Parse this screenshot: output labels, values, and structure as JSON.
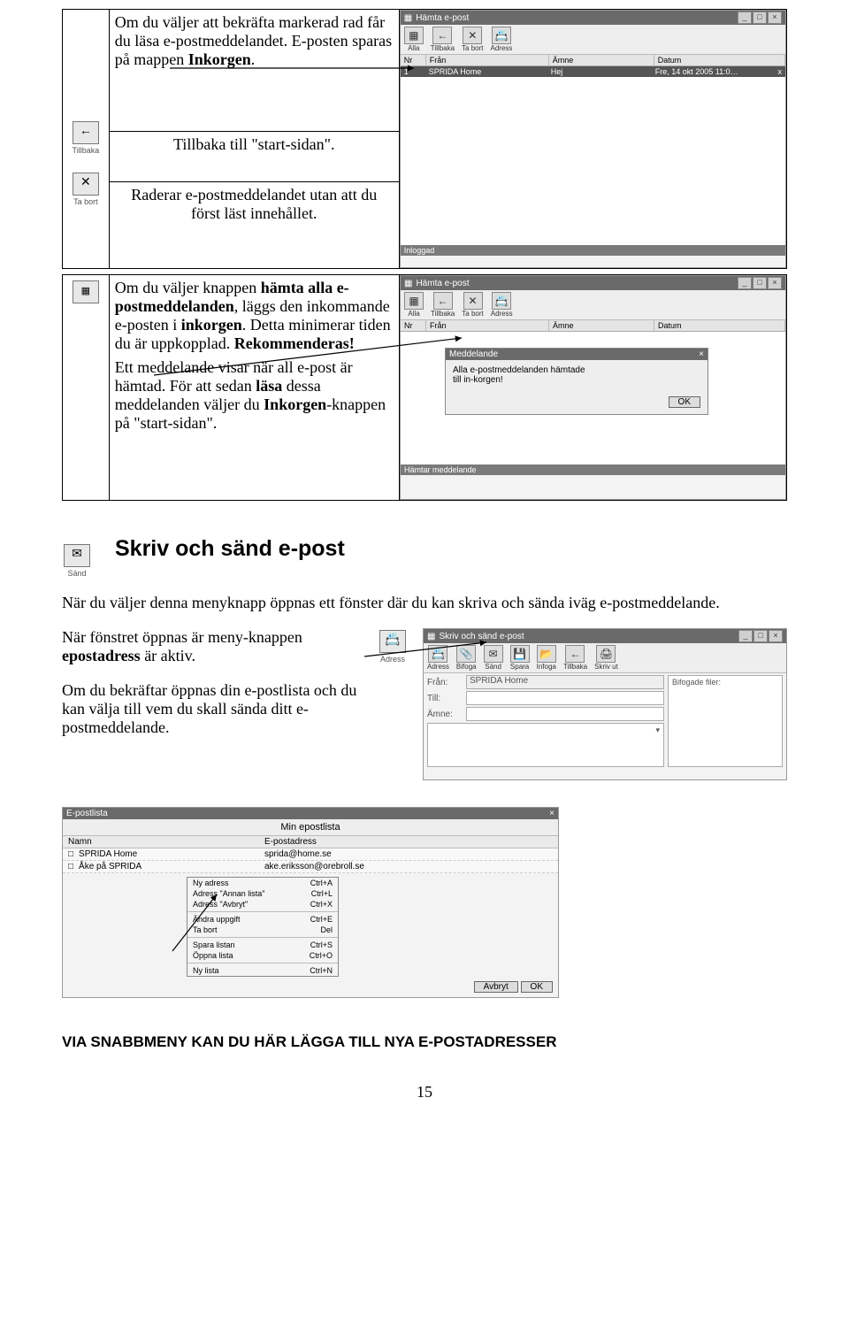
{
  "row1": {
    "para1_a": "Om du väljer att bekräfta markerad rad får du läsa e-postmeddelandet. E-posten sparas på mappen ",
    "para1_b": "Inkorgen",
    "para1_c": ".",
    "para2": "Tillbaka till \"start-sidan\".",
    "para3": "Raderar e-postmeddelandet utan att du först läst innehållet.",
    "tillbaka_label": "Tillbaka",
    "tabort_label": "Ta bort"
  },
  "win1": {
    "title": "Hämta e-post",
    "tb": {
      "alla": "Alla",
      "tillbaka": "Tillbaka",
      "tabort": "Ta bort",
      "adress": "Adress"
    },
    "cols": {
      "nr": "Nr",
      "fran": "Från",
      "amne": "Ämne",
      "datum": "Datum"
    },
    "row": {
      "nr": "1",
      "fran": "SPRIDA Home",
      "amne": "Hej",
      "datum": "Fre, 14 okt 2005 11:0…",
      "x": "x"
    },
    "status": "Inloggad"
  },
  "row2": {
    "p1_a": "Om du väljer knappen ",
    "p1_b": "hämta alla e-postmeddelanden",
    "p1_c": ", läggs den inkommande e-posten i ",
    "p1_d": "inkorgen",
    "p1_e": ". Detta minimerar tiden du är uppkopplad. ",
    "p1_f": "Rekommenderas!",
    "p2_a": "Ett meddelande visar när all e-post är hämtad. För att sedan ",
    "p2_b": "läsa",
    "p2_c": " dessa meddelanden väljer du ",
    "p2_d": "Inkorgen",
    "p2_e": "-knappen på \"start-sidan\"."
  },
  "win2": {
    "title": "Hämta e-post",
    "dlg": {
      "title": "Meddelande",
      "line1": "Alla e-postmeddelanden hämtade",
      "line2": "till in-korgen!",
      "ok": "OK"
    },
    "status": "Hämtar meddelande"
  },
  "section_send": {
    "heading": "Skriv och sänd e-post",
    "send_label": "Sänd",
    "p1": "När du väljer denna menyknapp öppnas ett fönster där du kan skriva och sända iväg e-postmeddelande.",
    "p2_a": "När fönstret öppnas är meny-knappen ",
    "p2_b": "epostadress",
    "p2_c": " är aktiv.",
    "adress_label": "Adress",
    "p3": "Om du bekräftar öppnas din e-postlista och du kan välja till vem du skall sända ditt e-postmeddelande."
  },
  "compose": {
    "title": "Skriv och sänd e-post",
    "tb": {
      "adress": "Adress",
      "bifoga": "Bifoga",
      "sand": "Sänd",
      "spara": "Spara",
      "infoga": "Infoga",
      "tillbaka": "Tillbaka",
      "skrivut": "Skriv ut"
    },
    "fran": "Från:",
    "till": "Till:",
    "amne": "Ämne:",
    "fran_value": "SPRIDA Home",
    "attach": "Bifogade filer:"
  },
  "eplist": {
    "title": "E-postlista",
    "caption": "Min epostlista",
    "col_name": "Namn",
    "col_addr": "E-postadress",
    "rows": [
      {
        "name": "SPRIDA Home",
        "addr": "sprida@home.se"
      },
      {
        "name": "Åke på SPRIDA",
        "addr": "ake.eriksson@orebroll.se"
      }
    ],
    "menu": {
      "ny_adress": "Ny adress",
      "ny_adress_sc": "Ctrl+A",
      "annan": "Adress \"Annan lista\"",
      "annan_sc": "Ctrl+L",
      "avbryt": "Adress \"Avbryt\"",
      "avbryt_sc": "Ctrl+X",
      "andra": "Ändra uppgift",
      "andra_sc": "Ctrl+E",
      "tabort": "Ta bort",
      "tabort_sc": "Del",
      "spara": "Spara listan",
      "spara_sc": "Ctrl+S",
      "oppna": "Öppna lista",
      "oppna_sc": "Ctrl+O",
      "ny_lista": "Ny lista",
      "ny_lista_sc": "Ctrl+N"
    },
    "avbryt_btn": "Avbryt",
    "ok_btn": "OK"
  },
  "bottom": {
    "heading": "VIA SNABBMENY KAN DU HÄR LÄGGA TILL NYA E-POSTADRESSER"
  },
  "page_number": "15"
}
